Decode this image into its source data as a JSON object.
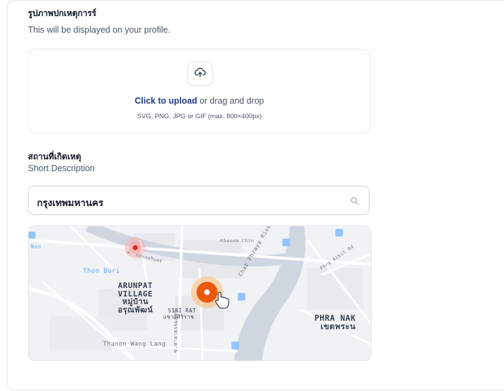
{
  "photo_section": {
    "title": "รูปภาพปกเหตุการร์",
    "subtitle": "This will be displayed on your profile."
  },
  "upload": {
    "link_label": "Click to upload",
    "rest_label": " or drag and drop",
    "hint": "SVG, PNG, JPG or GIF (max. 800×400px)",
    "icon": "upload-cloud-icon"
  },
  "location_section": {
    "title": "สถานที่เกิดเหตุ",
    "subtitle": "Short Description"
  },
  "search": {
    "value": "กรุงเทพมหานคร",
    "icon": "search-icon"
  },
  "map": {
    "labels": {
      "thon_buri": "Thon Buri",
      "arunpat_en": "ARUNPAT",
      "village_en": "VILLAGE",
      "muban_th": "หมู่บ้าน",
      "arunphat_th": "อรุณพัฒน์",
      "siri_rat": "SIRI RAT",
      "siri_rat_th": "แขวงศิริราช",
      "wang_lang": "Thanon Wang Lang",
      "chao_phraya": "Chao Phraya River",
      "phra_nak": "PHRA NAK",
      "phra_nak_th": "เขตพระน",
      "phra_athit": "Phra Athit Rd",
      "khanom_chin": "Khanom Chin",
      "non": "Non",
      "thai_road": "ซ. อรุณอมรินทร์",
      "vertical_road": "ซ.ศาลาธรรมสพน์"
    },
    "accent_color": "#ea580c",
    "pin_color": "#dc2626"
  }
}
